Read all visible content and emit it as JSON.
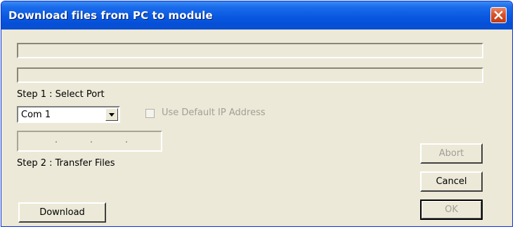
{
  "window": {
    "title": "Download files from PC to module"
  },
  "progress": {
    "bar1_fill": 0,
    "bar2_fill": 0
  },
  "step1": {
    "label": "Step 1 : Select Port",
    "port_value": "Com 1",
    "checkbox_label": "Use Default IP Address",
    "checkbox_checked": false
  },
  "step2": {
    "label": "Step 2 : Transfer Files"
  },
  "buttons": {
    "abort": "Abort",
    "cancel": "Cancel",
    "ok": "OK",
    "download": "Download"
  },
  "icons": {
    "close": "close-icon",
    "dropdown": "chevron-down-icon"
  },
  "colors": {
    "title_bar": "#0a58e0",
    "close_button": "#d9532b",
    "window_bg": "#ece9d8",
    "disabled_text": "#a19f95"
  }
}
